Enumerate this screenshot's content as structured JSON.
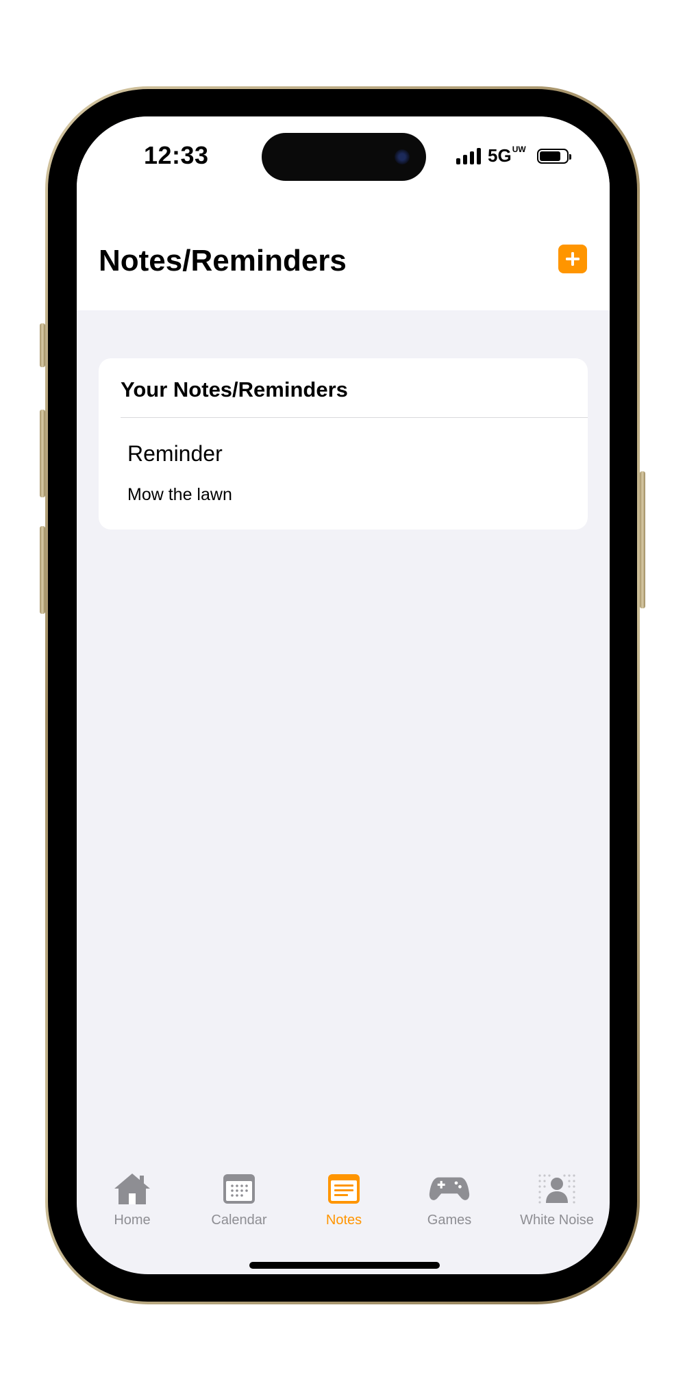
{
  "status_bar": {
    "time": "12:33",
    "network": "5G",
    "network_sub": "UW"
  },
  "header": {
    "title": "Notes/Reminders",
    "add_icon": "plus-icon"
  },
  "notes_card": {
    "heading": "Your Notes/Reminders",
    "items": [
      {
        "title": "Reminder",
        "body": "Mow the lawn"
      }
    ]
  },
  "tab_bar": {
    "tabs": [
      {
        "label": "Home",
        "icon": "house-icon",
        "active": false
      },
      {
        "label": "Calendar",
        "icon": "calendar-icon",
        "active": false
      },
      {
        "label": "Notes",
        "icon": "note-icon",
        "active": true
      },
      {
        "label": "Games",
        "icon": "gamepad-icon",
        "active": false
      },
      {
        "label": "White Noise",
        "icon": "white-noise-icon",
        "active": false
      }
    ]
  },
  "colors": {
    "accent": "#ff9500",
    "inactive": "#8e8e93",
    "background": "#f2f2f7",
    "card": "#ffffff"
  }
}
